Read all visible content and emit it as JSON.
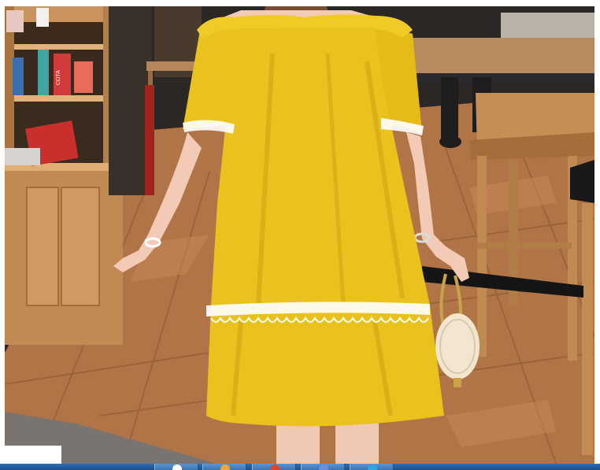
{
  "photo": {
    "subject": "woman-in-yellow-off-shoulder-dress",
    "colors": {
      "dress": "#e9c11c",
      "dress_shadow": "#c99d12",
      "lace_trim": "#ffffff",
      "floor": "#b5794a",
      "floor_dark": "#8d5a32",
      "shelf_wood": "#c8935c",
      "background": "#2a2623",
      "skin": "#f1c9b3",
      "handbag": "#f2e6d0",
      "chain": "#c9a24a"
    },
    "cup_label": "COTA"
  },
  "taskbar": {
    "buttons": [
      {
        "name": "taskbar-button-1",
        "icon": "globe-icon",
        "color": "#ffffff"
      },
      {
        "name": "taskbar-button-2",
        "icon": "folder-icon",
        "color": "#f0a63b"
      },
      {
        "name": "taskbar-button-3",
        "icon": "app-icon",
        "color": "#d8472c"
      },
      {
        "name": "taskbar-button-4",
        "icon": "people-icon",
        "color": "#6b8fe0"
      },
      {
        "name": "taskbar-button-5",
        "icon": "chat-icon",
        "color": "#2aa9e0"
      }
    ]
  }
}
